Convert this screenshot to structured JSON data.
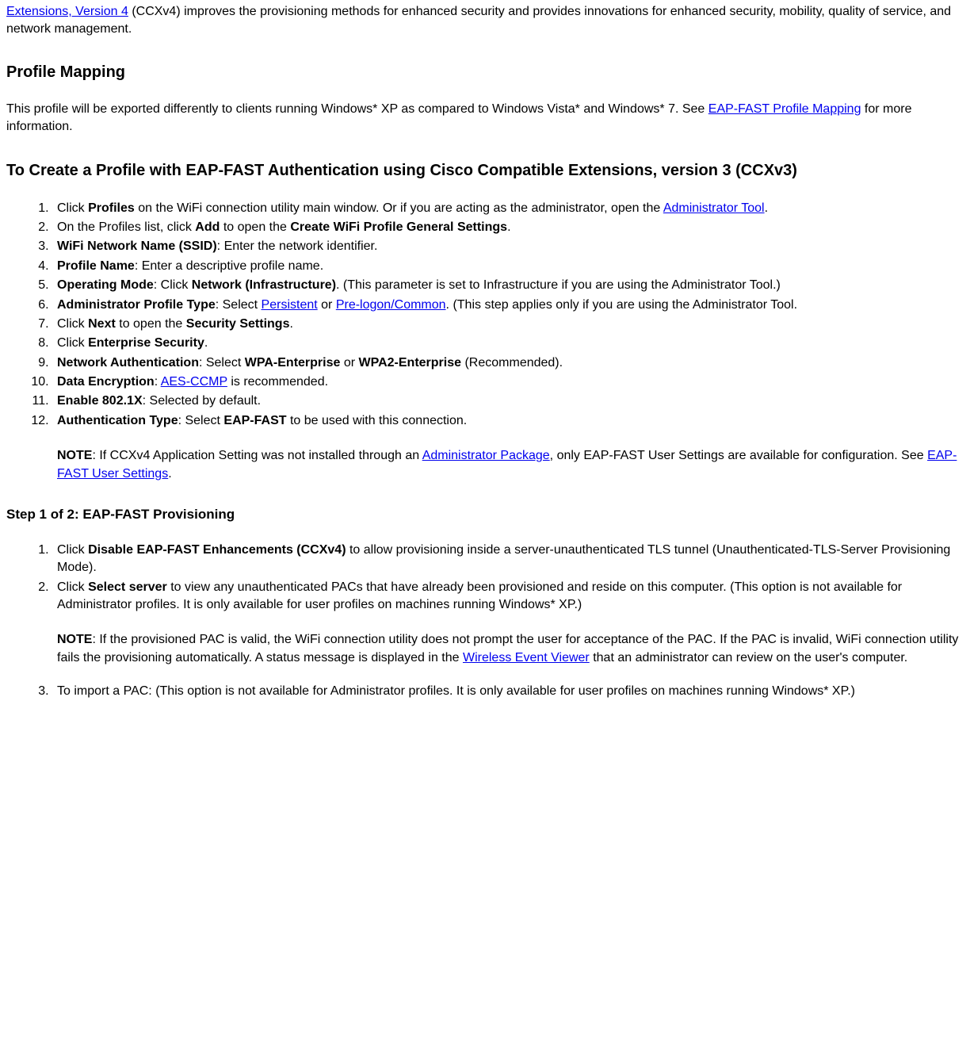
{
  "intro": {
    "link_text": "Extensions, Version 4",
    "after_link": " (CCXv4) improves the provisioning methods for enhanced security and provides innovations for enhanced security, mobility, quality of service, and network management."
  },
  "profile_mapping": {
    "heading": "Profile Mapping",
    "p_before_link": "This profile will be exported differently to clients running Windows* XP as compared to Windows Vista* and Windows* 7. See ",
    "link": "EAP-FAST Profile Mapping",
    "p_after_link": " for more information."
  },
  "create_profile": {
    "heading": "To Create a Profile with EAP-FAST Authentication using Cisco Compatible Extensions, version 3 (CCXv3)",
    "items": {
      "i1": {
        "pre": "Click ",
        "b1": "Profiles",
        "mid": " on the WiFi connection utility main window. Or if you are acting as the administrator, open the ",
        "link": "Administrator Tool",
        "post": "."
      },
      "i2": {
        "pre": "On the Profiles list, click ",
        "b1": "Add",
        "mid": " to open the ",
        "b2": "Create WiFi Profile General Settings",
        "post": "."
      },
      "i3": {
        "b1": "WiFi Network Name (SSID)",
        "post": ": Enter the network identifier."
      },
      "i4": {
        "b1": "Profile Name",
        "post": ": Enter a descriptive profile name."
      },
      "i5": {
        "b1": "Operating Mode",
        "mid": ": Click ",
        "b2": "Network (Infrastructure)",
        "post": ". (This parameter is set to Infrastructure if you are using the Administrator Tool.)"
      },
      "i6": {
        "b1": "Administrator Profile Type",
        "mid": ": Select ",
        "link1": "Persistent",
        "or": " or ",
        "link2": "Pre-logon/Common",
        "post": ". (This step applies only if you are using the Administrator Tool."
      },
      "i7": {
        "pre": "Click ",
        "b1": "Next",
        "mid": " to open the ",
        "b2": "Security Settings",
        "post": "."
      },
      "i8": {
        "pre": "Click ",
        "b1": "Enterprise Security",
        "post": "."
      },
      "i9": {
        "b1": "Network Authentication",
        "mid": ": Select ",
        "b2": "WPA-Enterprise",
        "or": " or ",
        "b3": "WPA2-Enterprise",
        "post": " (Recommended)."
      },
      "i10": {
        "b1": "Data Encryption",
        "mid": ": ",
        "link": "AES-CCMP",
        "post": " is recommended."
      },
      "i11": {
        "b1": "Enable 802.1X",
        "post": ": Selected by default."
      },
      "i12": {
        "b1": "Authentication Type",
        "mid": ": Select ",
        "b2": "EAP-FAST",
        "post": " to be used with this connection."
      }
    },
    "note": {
      "label": "NOTE",
      "pre": ": If CCXv4 Application Setting was not installed through an ",
      "link1": "Administrator Package",
      "mid": ", only EAP-FAST User Settings are available for configuration. See ",
      "link2": "EAP-FAST User Settings",
      "post": "."
    }
  },
  "step1": {
    "heading": "Step 1 of 2: EAP-FAST Provisioning",
    "items": {
      "i1": {
        "pre": "Click ",
        "b1": "Disable EAP-FAST Enhancements (CCXv4)",
        "post": " to allow provisioning inside a server-unauthenticated TLS tunnel (Unauthenticated-TLS-Server Provisioning Mode)."
      },
      "i2": {
        "pre": "Click ",
        "b1": "Select server",
        "post": " to view any unauthenticated PACs that have already been provisioned and reside on this computer. (This option is not available for Administrator profiles. It is only available for user profiles on machines running Windows* XP.)"
      }
    },
    "note": {
      "label": "NOTE",
      "pre": ": If the provisioned PAC is valid, the WiFi connection utility does not prompt the user for acceptance of the PAC. If the PAC is invalid, WiFi connection utility fails the provisioning automatically. A status message is displayed in the ",
      "link": "Wireless Event Viewer",
      "post": " that an administrator can review on the user's computer."
    },
    "i3": {
      "text": "To import a PAC: (This option is not available for Administrator profiles. It is only available for user profiles on machines running Windows* XP.)"
    }
  }
}
